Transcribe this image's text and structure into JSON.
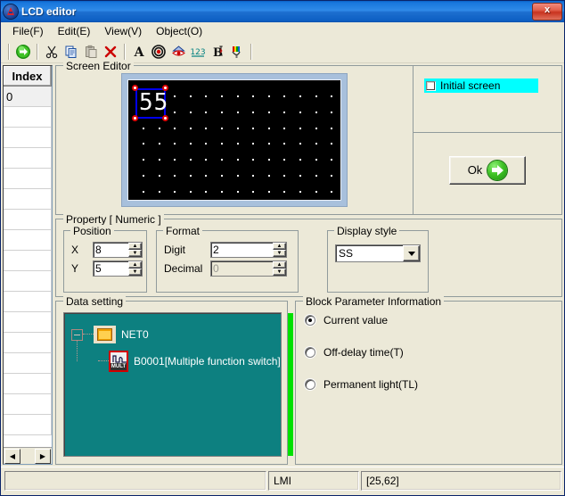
{
  "window": {
    "title": "LCD editor",
    "icon": "app-icon",
    "close_label": "x"
  },
  "menu": [
    {
      "label": "File(F)"
    },
    {
      "label": "Edit(E)"
    },
    {
      "label": "View(V)"
    },
    {
      "label": "Object(O)"
    }
  ],
  "toolbar": [
    {
      "name": "run-icon",
      "glyph": "➤"
    },
    {
      "name": "cut-icon",
      "glyph": "✂"
    },
    {
      "name": "copy-icon",
      "glyph": "❐"
    },
    {
      "name": "paste-icon",
      "glyph": "Ὄb"
    },
    {
      "name": "delete-icon",
      "glyph": "✕"
    },
    {
      "name": "text-icon",
      "glyph": "A"
    },
    {
      "name": "target-icon",
      "glyph": "◉"
    },
    {
      "name": "eye-icon",
      "glyph": "◉"
    },
    {
      "name": "numeric-icon",
      "glyph": "123"
    },
    {
      "name": "bitmap-text-icon",
      "glyph": "B"
    },
    {
      "name": "picture-icon",
      "glyph": "❁"
    }
  ],
  "index_panel": {
    "header": "Index",
    "rows": [
      "0",
      "",
      "",
      "",
      "",
      "",
      "",
      "",
      "",
      "",
      "",
      "",
      "",
      "",
      "",
      "",
      ""
    ],
    "scroll_left": "◀",
    "scroll_right": "▶"
  },
  "screen_editor": {
    "title": "Screen Editor",
    "lcd": {
      "display_text": "55",
      "grid_cols": 13,
      "grid_rows": 7,
      "dot_color": "#ffffff",
      "background": "#000000",
      "selection_color": "#0000ee",
      "handle_color": "#e00000"
    },
    "initial_screen": {
      "label": "Initial screen",
      "checked": false,
      "highlight_color": "#00ffff"
    },
    "ok_button": {
      "label": "Ok",
      "icon": "green-arrow-icon"
    }
  },
  "property": {
    "title": "Property [ Numeric ]",
    "position": {
      "title": "Position",
      "x_label": "X",
      "x_value": "8",
      "y_label": "Y",
      "y_value": "5"
    },
    "format": {
      "title": "Format",
      "digit_label": "Digit",
      "digit_value": "2",
      "decimal_label": "Decimal",
      "decimal_value": "0",
      "decimal_disabled": true
    },
    "display_style": {
      "title": "Display style",
      "value": "SS",
      "options": [
        "SS"
      ]
    }
  },
  "data_setting": {
    "title": "Data setting",
    "background": "#0d8080",
    "root": {
      "label": "NET0",
      "icon": "folder-icon",
      "expander": "-"
    },
    "child": {
      "label": "B0001[Multiple function switch]",
      "icon": "mult-block-icon",
      "icon_text": "MULT"
    }
  },
  "block_parameter": {
    "title": "Block Parameter Information",
    "options": [
      {
        "label": "Current value",
        "selected": true
      },
      {
        "label": "Off-delay time(T)",
        "selected": false
      },
      {
        "label": "Permanent light(TL)",
        "selected": false
      }
    ]
  },
  "status_bar": {
    "pane1": "",
    "pane2": "LMI",
    "pane3": "[25,62]"
  }
}
